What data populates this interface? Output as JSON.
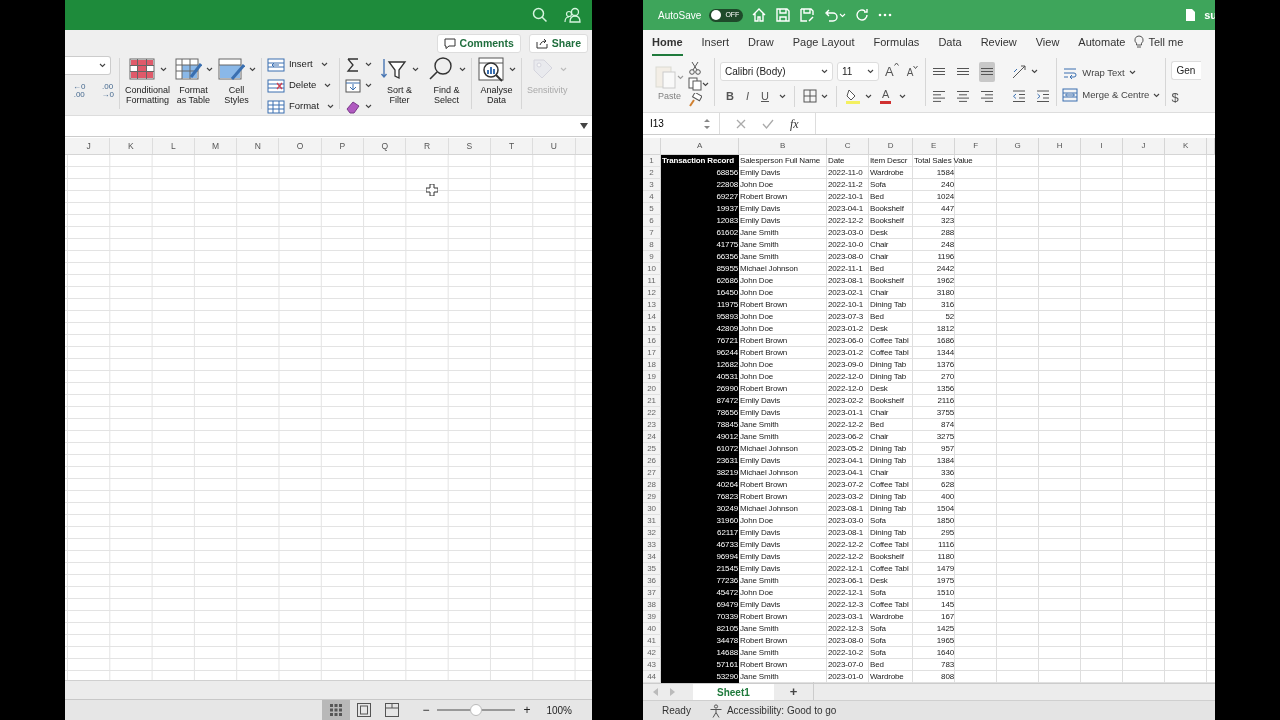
{
  "left_window": {
    "header_buttons": [
      {
        "kind": "comments",
        "label": "Comments"
      },
      {
        "kind": "share",
        "label": "Share"
      }
    ],
    "ribbon_groups": [
      {
        "kind": "number",
        "decimals": [
          {
            "lines": [
              "←0",
              ".00"
            ]
          },
          {
            "lines": [
              ".00",
              "→0"
            ]
          }
        ]
      },
      {
        "kind": "large",
        "buttons": [
          {
            "kind": "conditional",
            "lines": [
              "Conditional",
              "Formatting"
            ],
            "disabled": false
          },
          {
            "kind": "table",
            "lines": [
              "Format",
              "as Table"
            ],
            "disabled": false
          },
          {
            "kind": "styles",
            "lines": [
              "Cell",
              "Styles"
            ],
            "disabled": false
          }
        ]
      },
      {
        "kind": "cells",
        "buttons": [
          {
            "kind": "insert",
            "label": "Insert"
          },
          {
            "kind": "delete",
            "label": "Delete"
          },
          {
            "kind": "format",
            "label": "Format"
          }
        ]
      },
      {
        "kind": "editing",
        "buttons": [
          {
            "kind": "sort",
            "lines": [
              "Sort &",
              "Filter"
            ],
            "disabled": false
          },
          {
            "kind": "find",
            "lines": [
              "Find &",
              "Select"
            ],
            "disabled": false
          }
        ]
      },
      {
        "kind": "large",
        "buttons": [
          {
            "kind": "analyse",
            "lines": [
              "Analyse",
              "Data"
            ],
            "disabled": false
          }
        ]
      },
      {
        "kind": "large",
        "buttons": [
          {
            "kind": "sensitivity",
            "lines": [
              "Sensitivity"
            ],
            "disabled": true
          }
        ]
      }
    ],
    "columns": [
      "J",
      "K",
      "L",
      "M",
      "N",
      "O",
      "P",
      "Q",
      "R",
      "S",
      "T",
      "U"
    ],
    "view_buttons": [
      {
        "kind": "normal",
        "selected": true
      },
      {
        "kind": "page_layout",
        "selected": false
      },
      {
        "kind": "page_break",
        "selected": false
      }
    ],
    "zoom": {
      "minus": "−",
      "plus": "+",
      "level": 0.5,
      "reading": "100%"
    }
  },
  "right_window": {
    "autosave": {
      "label": "AutoSave",
      "on": false,
      "state_text": "OFF"
    },
    "file_name": "su",
    "tabs": [
      {
        "label": "Home",
        "selected": true
      },
      {
        "label": "Insert",
        "selected": false
      },
      {
        "label": "Draw",
        "selected": false
      },
      {
        "label": "Page Layout",
        "selected": false
      },
      {
        "label": "Formulas",
        "selected": false
      },
      {
        "label": "Data",
        "selected": false
      },
      {
        "label": "Review",
        "selected": false
      },
      {
        "label": "View",
        "selected": false
      },
      {
        "label": "Automate",
        "selected": false
      }
    ],
    "tell_me": "Tell me",
    "clipboard": {
      "paste_label": "Paste",
      "paste_disabled": true
    },
    "font": {
      "name": "Calibri (Body)",
      "size": "11",
      "grow": "A",
      "shrink": "A",
      "styles": [
        {
          "kind": "bold",
          "label": "B"
        },
        {
          "kind": "italic",
          "label": "I"
        },
        {
          "kind": "underline",
          "label": "U"
        }
      ],
      "color_label": "A"
    },
    "vertical_align": [
      {
        "selected": false
      },
      {
        "selected": false
      },
      {
        "selected": true
      }
    ],
    "wrap_text": "Wrap Text",
    "merge": "Merge & Centre",
    "number_format": "Gen",
    "currency": "$",
    "name_box": "I13",
    "fx": "fx",
    "columns": [
      {
        "letter": "A",
        "dark": true,
        "kind": "number"
      },
      {
        "letter": "B",
        "dark": false,
        "kind": "text"
      },
      {
        "letter": "C",
        "dark": false,
        "kind": "text"
      },
      {
        "letter": "D",
        "dark": false,
        "kind": "text"
      },
      {
        "letter": "E",
        "dark": false,
        "kind": "number"
      },
      {
        "letter": "F",
        "dark": false,
        "kind": "text"
      },
      {
        "letter": "G",
        "dark": false,
        "kind": "text"
      },
      {
        "letter": "H",
        "dark": false,
        "kind": "text"
      },
      {
        "letter": "I",
        "dark": false,
        "kind": "text"
      },
      {
        "letter": "J",
        "dark": false,
        "kind": "text"
      },
      {
        "letter": "K",
        "dark": false,
        "kind": "text"
      }
    ],
    "rows": [
      {
        "n": "1",
        "kind": "header",
        "cells": [
          "Transaction Record",
          "Salesperson Full Name",
          "Date",
          "Item Descr",
          "Total Sales Value"
        ]
      },
      {
        "n": "2",
        "kind": "data",
        "cells": [
          "68856",
          "Emily Davis",
          "2022-11-0",
          "Wardrobe",
          "1584"
        ]
      },
      {
        "n": "3",
        "kind": "data",
        "cells": [
          "22808",
          "John Doe",
          "2022-11-2",
          "Sofa",
          "240"
        ]
      },
      {
        "n": "4",
        "kind": "data",
        "cells": [
          "69227",
          "Robert Brown",
          "2022-10-1",
          "Bed",
          "1024"
        ]
      },
      {
        "n": "5",
        "kind": "data",
        "cells": [
          "19937",
          "Emily Davis",
          "2023-04-1",
          "Bookshelf",
          "447"
        ]
      },
      {
        "n": "6",
        "kind": "data",
        "cells": [
          "12083",
          "Emily Davis",
          "2022-12-2",
          "Bookshelf",
          "323"
        ]
      },
      {
        "n": "7",
        "kind": "data",
        "cells": [
          "61602",
          "Jane Smith",
          "2023-03-0",
          "Desk",
          "288"
        ]
      },
      {
        "n": "8",
        "kind": "data",
        "cells": [
          "41775",
          "Jane Smith",
          "2022-10-0",
          "Chair",
          "248"
        ]
      },
      {
        "n": "9",
        "kind": "data",
        "cells": [
          "66356",
          "Jane Smith",
          "2023-08-0",
          "Chair",
          "1196"
        ]
      },
      {
        "n": "10",
        "kind": "data",
        "cells": [
          "85955",
          "Michael Johnson",
          "2022-11-1",
          "Bed",
          "2442"
        ]
      },
      {
        "n": "11",
        "kind": "data",
        "cells": [
          "62686",
          "John Doe",
          "2023-08-1",
          "Bookshelf",
          "1962"
        ]
      },
      {
        "n": "12",
        "kind": "data",
        "cells": [
          "16450",
          "John Doe",
          "2023-02-1",
          "Chair",
          "3180"
        ]
      },
      {
        "n": "13",
        "kind": "data",
        "cells": [
          "11975",
          "Robert Brown",
          "2022-10-1",
          "Dining Tab",
          "316"
        ]
      },
      {
        "n": "14",
        "kind": "data",
        "cells": [
          "95893",
          "John Doe",
          "2023-07-3",
          "Bed",
          "52"
        ]
      },
      {
        "n": "15",
        "kind": "data",
        "cells": [
          "42809",
          "John Doe",
          "2023-01-2",
          "Desk",
          "1812"
        ]
      },
      {
        "n": "16",
        "kind": "data",
        "cells": [
          "76721",
          "Robert Brown",
          "2023-06-0",
          "Coffee Tabl",
          "1686"
        ]
      },
      {
        "n": "17",
        "kind": "data",
        "cells": [
          "96244",
          "Robert Brown",
          "2023-01-2",
          "Coffee Tabl",
          "1344"
        ]
      },
      {
        "n": "18",
        "kind": "data",
        "cells": [
          "12682",
          "John Doe",
          "2023-09-0",
          "Dining Tab",
          "1376"
        ]
      },
      {
        "n": "19",
        "kind": "data",
        "cells": [
          "40531",
          "John Doe",
          "2022-12-0",
          "Dining Tab",
          "270"
        ]
      },
      {
        "n": "20",
        "kind": "data",
        "cells": [
          "26990",
          "Robert Brown",
          "2022-12-0",
          "Desk",
          "1356"
        ]
      },
      {
        "n": "21",
        "kind": "data",
        "cells": [
          "87472",
          "Emily Davis",
          "2023-02-2",
          "Bookshelf",
          "2116"
        ]
      },
      {
        "n": "22",
        "kind": "data",
        "cells": [
          "78656",
          "Emily Davis",
          "2023-01-1",
          "Chair",
          "3755"
        ]
      },
      {
        "n": "23",
        "kind": "data",
        "cells": [
          "78845",
          "Jane Smith",
          "2022-12-2",
          "Bed",
          "874"
        ]
      },
      {
        "n": "24",
        "kind": "data",
        "cells": [
          "49012",
          "Jane Smith",
          "2023-06-2",
          "Chair",
          "3275"
        ]
      },
      {
        "n": "25",
        "kind": "data",
        "cells": [
          "61072",
          "Michael Johnson",
          "2023-05-2",
          "Dining Tab",
          "957"
        ]
      },
      {
        "n": "26",
        "kind": "data",
        "cells": [
          "23631",
          "Emily Davis",
          "2023-04-1",
          "Dining Tab",
          "1384"
        ]
      },
      {
        "n": "27",
        "kind": "data",
        "cells": [
          "38219",
          "Michael Johnson",
          "2023-04-1",
          "Chair",
          "336"
        ]
      },
      {
        "n": "28",
        "kind": "data",
        "cells": [
          "40264",
          "Robert Brown",
          "2023-07-2",
          "Coffee Tabl",
          "628"
        ]
      },
      {
        "n": "29",
        "kind": "data",
        "cells": [
          "76823",
          "Robert Brown",
          "2023-03-2",
          "Dining Tab",
          "400"
        ]
      },
      {
        "n": "30",
        "kind": "data",
        "cells": [
          "30249",
          "Michael Johnson",
          "2023-08-1",
          "Dining Tab",
          "1504"
        ]
      },
      {
        "n": "31",
        "kind": "data",
        "cells": [
          "31960",
          "John Doe",
          "2023-03-0",
          "Sofa",
          "1850"
        ]
      },
      {
        "n": "32",
        "kind": "data",
        "cells": [
          "62117",
          "Emily Davis",
          "2023-08-1",
          "Dining Tab",
          "295"
        ]
      },
      {
        "n": "33",
        "kind": "data",
        "cells": [
          "46733",
          "Emily Davis",
          "2022-12-2",
          "Coffee Tabl",
          "1116"
        ]
      },
      {
        "n": "34",
        "kind": "data",
        "cells": [
          "96994",
          "Emily Davis",
          "2022-12-2",
          "Bookshelf",
          "1180"
        ]
      },
      {
        "n": "35",
        "kind": "data",
        "cells": [
          "21545",
          "Emily Davis",
          "2022-12-1",
          "Coffee Tabl",
          "1479"
        ]
      },
      {
        "n": "36",
        "kind": "data",
        "cells": [
          "77236",
          "Jane Smith",
          "2023-06-1",
          "Desk",
          "1975"
        ]
      },
      {
        "n": "37",
        "kind": "data",
        "cells": [
          "45472",
          "John Doe",
          "2022-12-1",
          "Sofa",
          "1510"
        ]
      },
      {
        "n": "38",
        "kind": "data",
        "cells": [
          "69479",
          "Emily Davis",
          "2022-12-3",
          "Coffee Tabl",
          "145"
        ]
      },
      {
        "n": "39",
        "kind": "data",
        "cells": [
          "70339",
          "Robert Brown",
          "2023-03-1",
          "Wardrobe",
          "167"
        ]
      },
      {
        "n": "40",
        "kind": "data",
        "cells": [
          "82105",
          "Jane Smith",
          "2022-12-3",
          "Sofa",
          "1425"
        ]
      },
      {
        "n": "41",
        "kind": "data",
        "cells": [
          "34478",
          "Robert Brown",
          "2023-08-0",
          "Sofa",
          "1965"
        ]
      },
      {
        "n": "42",
        "kind": "data",
        "cells": [
          "14688",
          "Jane Smith",
          "2022-10-2",
          "Sofa",
          "1640"
        ]
      },
      {
        "n": "43",
        "kind": "data",
        "cells": [
          "57161",
          "Robert Brown",
          "2023-07-0",
          "Bed",
          "783"
        ]
      },
      {
        "n": "44",
        "kind": "data",
        "cells": [
          "53290",
          "Jane Smith",
          "2023-01-0",
          "Wardrobe",
          "808"
        ]
      }
    ],
    "sheet_tabs": [
      {
        "label": "Sheet1",
        "selected": true
      }
    ],
    "add_sheet": "+",
    "status": "Ready",
    "accessibility": "Accessibility: Good to go"
  }
}
